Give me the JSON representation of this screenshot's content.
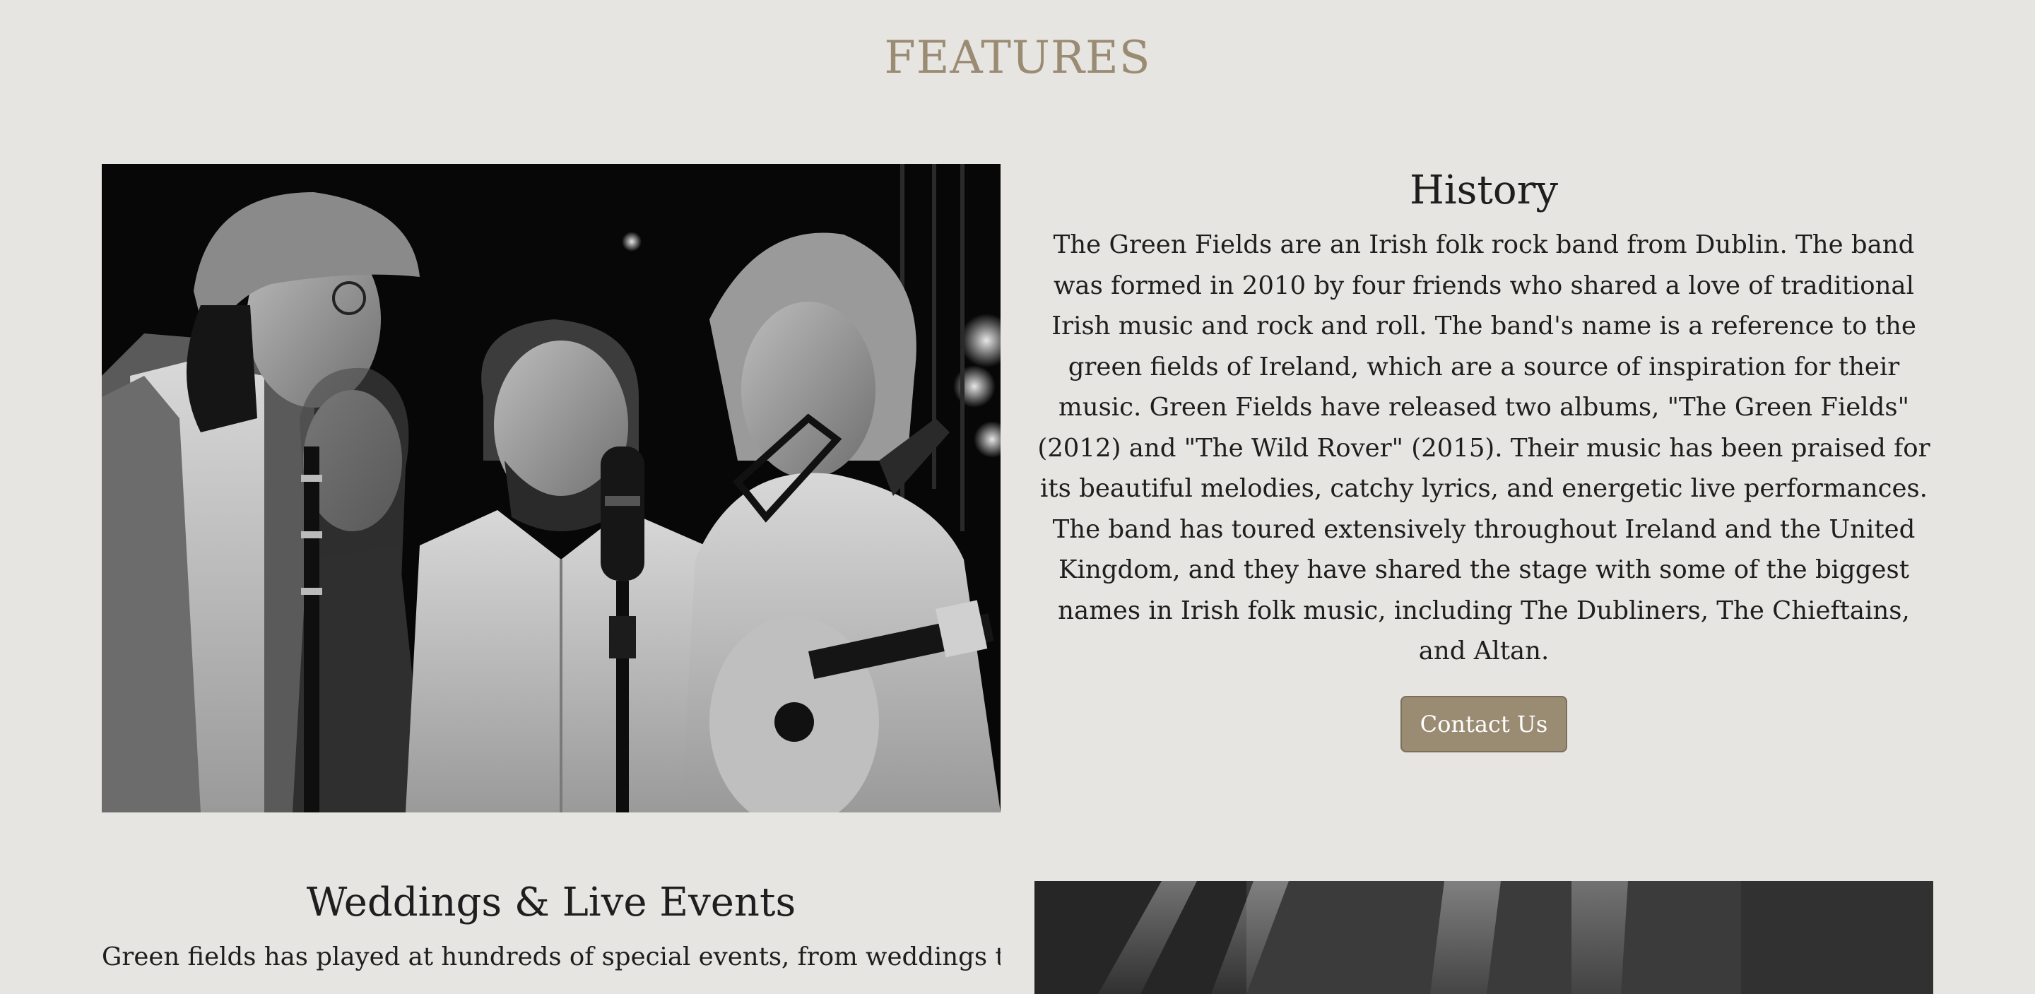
{
  "page": {
    "heading": "FEATURES"
  },
  "history": {
    "title": "History",
    "body": "The Green Fields are an Irish folk rock band from Dublin. The band was formed in 2010 by four friends who shared a love of traditional Irish music and rock and roll. The band's name is a reference to the green fields of Ireland, which are a source of inspiration for their music. Green Fields have released two albums, \"The Green Fields\" (2012) and \"The Wild Rover\" (2015). Their music has been praised for its beautiful melodies, catchy lyrics, and energetic live performances. The band has toured extensively throughout Ireland and the United Kingdom, and they have shared the stage with some of the biggest names in Irish folk music, including The Dubliners, The Chieftains, and Altan.",
    "button_label": "Contact Us"
  },
  "weddings": {
    "title": "Weddings & Live Events",
    "body_partial": "Green fields has played at hundreds of special events, from weddings to public events. W"
  },
  "colors": {
    "accent": "#9a8b73",
    "background": "#e7e5e1",
    "text": "#1e1e1e"
  }
}
